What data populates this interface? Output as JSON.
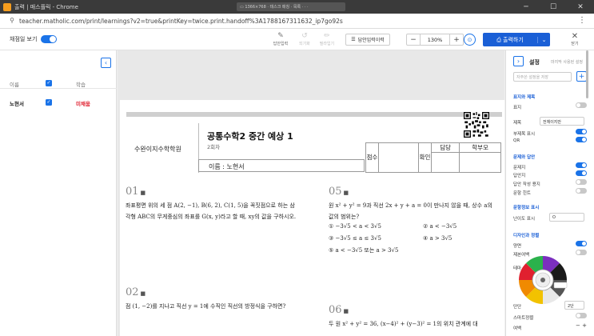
{
  "window": {
    "title": "출력 | 매스플릭 - Chrome",
    "center_tab": "▭  1366×768  ·  태스크 매칭 · 목록 ·  ·  ·"
  },
  "address": {
    "url": "teacher.matholic.com/print/learnings?v2=true&printKey=twice.print.handoff%3A1788167311632_ip7go92s"
  },
  "toolbar": {
    "answer_view_label": "채점일 보기",
    "tools": [
      {
        "icon": "edit-icon",
        "label": "답안입력"
      },
      {
        "icon": "undo-icon",
        "label": "되기화"
      },
      {
        "icon": "pencil-icon",
        "label": "필라입기"
      }
    ],
    "answer_sheet_button": "답안입력이력",
    "zoom_minus": "−",
    "zoom_value": "130%",
    "zoom_plus": "+",
    "print_button": "출력하기",
    "close_label": "닫기"
  },
  "left_panel": {
    "header": {
      "col1": "이름",
      "col3": "학습"
    },
    "rows": [
      {
        "name": "노현서",
        "status": "미채움"
      }
    ]
  },
  "paper": {
    "academy": "수완이지수학학원",
    "exam_title": "공통수학2 중간 예상 1",
    "round": "2회차",
    "name_field": "이름 : 노현서",
    "score_label": "점수",
    "confirm_label": "확인",
    "col_teacher": "담당",
    "col_parent": "학부모",
    "q1_num": "01",
    "q1_text": "좌표평면 위의 세 점 A(2, −1), B(6, 2), C(1, 5)을 꼭짓점으로 하는 삼각형 ABC의 무게중심의 좌표를 G(x, y)라고 할 때, xy의 값을 구하시오.",
    "q2_num": "02",
    "q2_text": "점 (1, −2)를 지나고 직선 y = 1에 수직인 직선의 방정식을 구하면?",
    "q5_num": "05",
    "q5_text": "원 x² + y² = 9과 직선 2x + y + a = 0이 만나지 않을 때, 상수 a의 값의 범위는?",
    "q5_choices": [
      "① −3√5 < a < 3√5",
      "② a < −3√5",
      "③ −3√5 ≤ a ≤ 3√5",
      "④ a > 3√5",
      "⑤ a < −3√5  또는  a > 3√5"
    ],
    "q6_num": "06",
    "q6_text": "두 원 x² + y² = 36, (x−4)² + (y−3)² = 1의 위치 관계에 대"
  },
  "right_panel": {
    "title": "설정",
    "subtitle": "마지막 사용된 설정",
    "select_placeholder": "자주쓴 설정을 저장",
    "sections": {
      "title_section": "표지와 제목",
      "answer_section": "문제와 답안",
      "info_section": "문항정보 표시",
      "design_section": "디자인과 정렬"
    },
    "items": {
      "cover": "표지",
      "title_label": "제목",
      "title_value": "전체이지만",
      "subtitle_label": "부제목 표시",
      "qr_label": "QR",
      "question_label": "문제지",
      "answer_label": "답안지",
      "answer_write_label": "답안 작성 용지",
      "hint_label": "문항 힌트",
      "difficulty_label": "난이도 표시",
      "difficulty_value": "O",
      "header_label": "양면",
      "footer_label": "제본여백",
      "theme_label": "테마",
      "column_label": "단단",
      "column_value": "2단",
      "smart_label": "스마트정렬",
      "margin_label": "여백"
    }
  },
  "colors": {
    "accent": "#1a73e8",
    "print_button": "#1a5fd6",
    "status_red": "#e0202f"
  }
}
